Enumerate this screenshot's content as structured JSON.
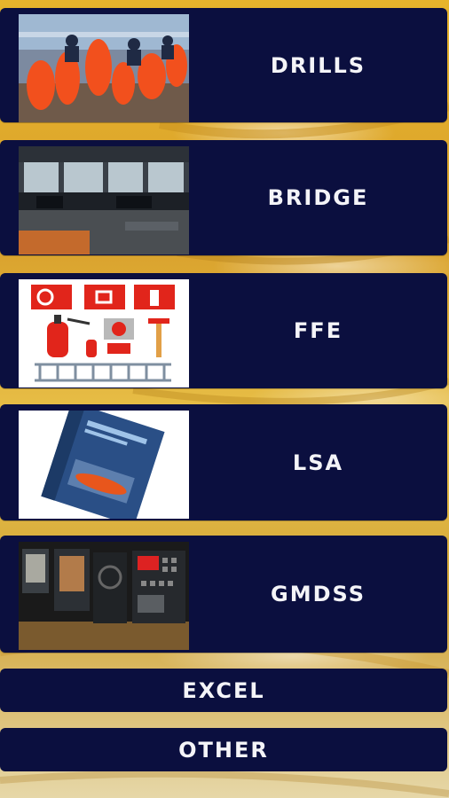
{
  "menu": {
    "items": [
      {
        "label": "DRILLS",
        "image": "lifesaving-suits-drill-photo"
      },
      {
        "label": "BRIDGE",
        "image": "ship-bridge-photo"
      },
      {
        "label": "FFE",
        "image": "fire-fighting-equipment-icons"
      },
      {
        "label": "LSA",
        "image": "life-saving-appliances-book-photo"
      },
      {
        "label": "GMDSS",
        "image": "radio-console-photo"
      }
    ],
    "excel_label": "EXCEL",
    "other_label": "OTHER"
  },
  "colors": {
    "card_background": "#0b0f3f",
    "label_text": "#f4f4f8",
    "background_gold": "#e7b42c"
  }
}
